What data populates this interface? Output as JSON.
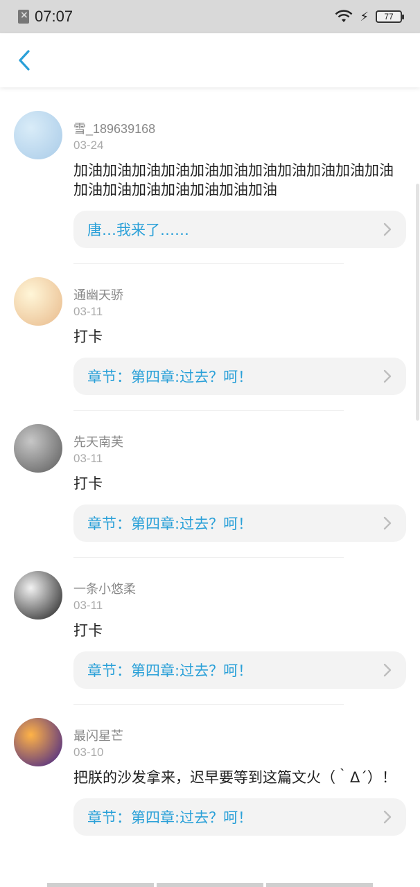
{
  "status": {
    "time": "07:07",
    "battery": "77"
  },
  "comments": [
    {
      "username": "雪_189639168",
      "date": "03-24",
      "text": "加油加油加油加油加油加油加油加油加油加油加油加油加油加油加油加油加油加油",
      "chapter": "唐…我来了……",
      "avatar_colors": [
        "#d9ecf8",
        "#a9cbe8"
      ]
    },
    {
      "username": "通幽天骄",
      "date": "03-11",
      "text": "打卡",
      "chapter": "章节：第四章:过去？呵！",
      "avatar_colors": [
        "#fff6d8",
        "#e8b98a"
      ]
    },
    {
      "username": "先天南芙",
      "date": "03-11",
      "text": "打卡",
      "chapter": "章节：第四章:过去？呵！",
      "avatar_colors": [
        "#c7c7c7",
        "#5a5a5a"
      ]
    },
    {
      "username": "一条小悠柔",
      "date": "03-11",
      "text": "打卡",
      "chapter": "章节：第四章:过去？呵！",
      "avatar_colors": [
        "#f2f2f2",
        "#1a1a1a"
      ]
    },
    {
      "username": "最闪星芒",
      "date": "03-10",
      "text": "把朕的沙发拿来，迟早要等到这篇文火（｀Δ´）！",
      "chapter": "章节：第四章:过去？呵！",
      "avatar_colors": [
        "#ffb347",
        "#3a1c8c"
      ]
    }
  ]
}
